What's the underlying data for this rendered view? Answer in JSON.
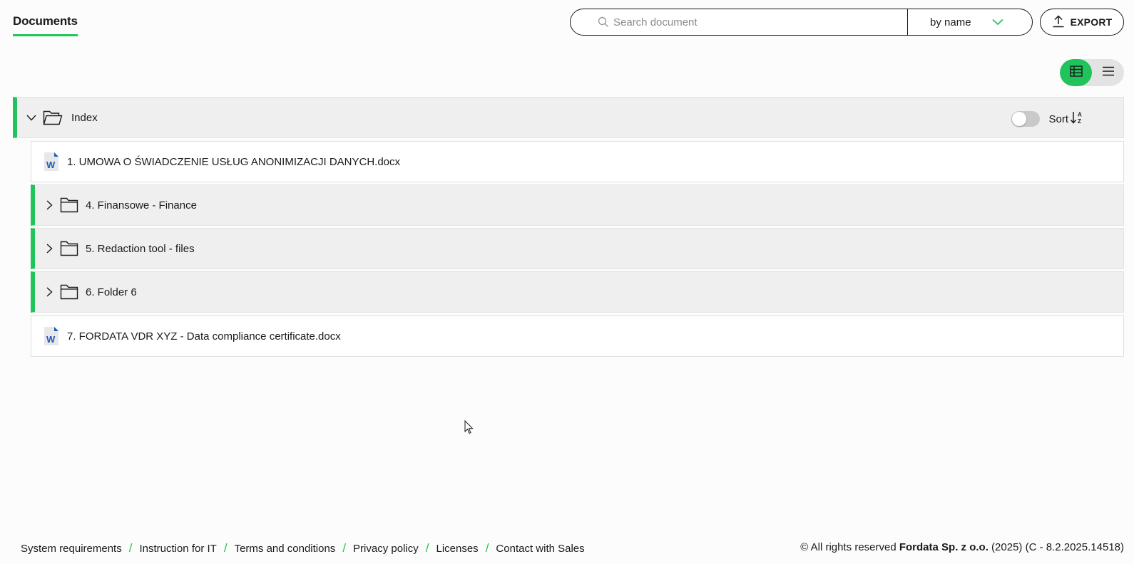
{
  "header": {
    "tab_title": "Documents",
    "search": {
      "placeholder": "Search document",
      "value": ""
    },
    "sort_by": {
      "selected": "by name"
    },
    "export_label": "EXPORT"
  },
  "view_toggle": {
    "active": "grid"
  },
  "tree": {
    "root": {
      "label": "Index",
      "expanded": true,
      "sort_label": "Sort",
      "sort_toggle_on": false
    },
    "items": [
      {
        "type": "file",
        "label": "1. UMOWA O ŚWIADCZENIE USŁUG ANONIMIZACJI DANYCH.docx",
        "icon": "word-doc-icon"
      },
      {
        "type": "folder",
        "label": "4. Finansowe - Finance",
        "expanded": false
      },
      {
        "type": "folder",
        "label": "5. Redaction tool - files",
        "expanded": false
      },
      {
        "type": "folder",
        "label": "6. Folder 6",
        "expanded": false
      },
      {
        "type": "file",
        "label": "7. FORDATA VDR XYZ - Data compliance certificate.docx",
        "icon": "word-doc-icon"
      }
    ]
  },
  "footer": {
    "links": [
      "System requirements",
      "Instruction for IT",
      "Terms and conditions",
      "Privacy policy",
      "Licenses",
      "Contact with Sales"
    ],
    "separator": "/",
    "copyright_prefix": "© All rights reserved",
    "company": "Fordata Sp. z o.o.",
    "copyright_suffix": "(2025) (C - 8.2.2025.14518)"
  },
  "colors": {
    "accent": "#1fc45a",
    "folder_bg": "#efefef",
    "word_blue": "#1f5bb5"
  }
}
